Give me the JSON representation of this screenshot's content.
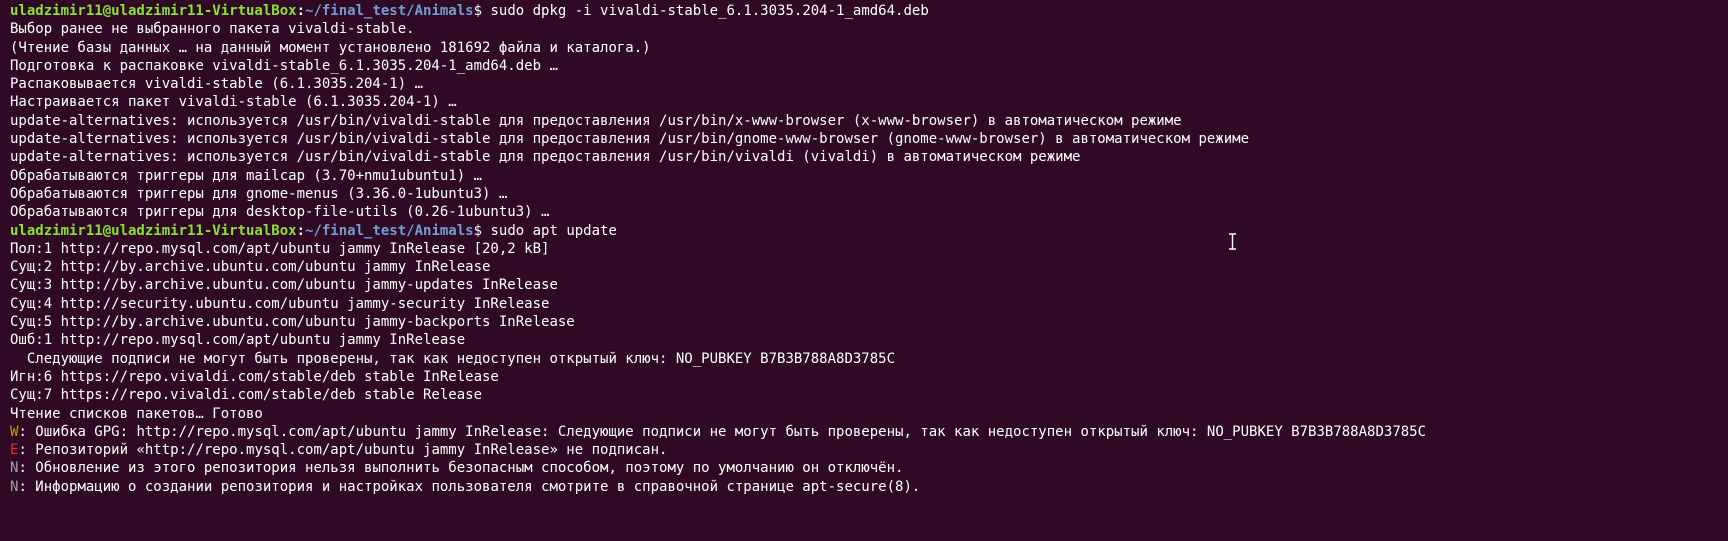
{
  "terminal": {
    "prompt": {
      "user_host": "uladzimir11@uladzimir11-VirtualBox",
      "separator": ":",
      "path": "~/final_test/Animals",
      "dollar": "$"
    },
    "colors": {
      "background": "#300a24",
      "user_host": "#8ae234",
      "path": "#729fcf",
      "text": "#ffffff",
      "warning_tag": "#c4a000",
      "error_tag": "#ef2929",
      "notice_tag": "#a0a0a0"
    },
    "commands": [
      " sudo dpkg -i vivaldi-stable_6.1.3035.204-1_amd64.deb",
      " sudo apt update"
    ],
    "dpkg_output": [
      "Выбор ранее не выбранного пакета vivaldi-stable.",
      "(Чтение базы данных … на данный момент установлено 181692 файла и каталога.)",
      "Подготовка к распаковке vivaldi-stable_6.1.3035.204-1_amd64.deb …",
      "Распаковывается vivaldi-stable (6.1.3035.204-1) …",
      "Настраивается пакет vivaldi-stable (6.1.3035.204-1) …",
      "update-alternatives: используется /usr/bin/vivaldi-stable для предоставления /usr/bin/x-www-browser (x-www-browser) в автоматическом режиме",
      "update-alternatives: используется /usr/bin/vivaldi-stable для предоставления /usr/bin/gnome-www-browser (gnome-www-browser) в автоматическом режиме",
      "update-alternatives: используется /usr/bin/vivaldi-stable для предоставления /usr/bin/vivaldi (vivaldi) в автоматическом режиме",
      "Обрабатываются триггеры для mailcap (3.70+nmu1ubuntu1) …",
      "Обрабатываются триггеры для gnome-menus (3.36.0-1ubuntu3) …",
      "Обрабатываются триггеры для desktop-file-utils (0.26-1ubuntu3) …"
    ],
    "apt_output": [
      "Пол:1 http://repo.mysql.com/apt/ubuntu jammy InRelease [20,2 kB]",
      "Сущ:2 http://by.archive.ubuntu.com/ubuntu jammy InRelease",
      "Сущ:3 http://by.archive.ubuntu.com/ubuntu jammy-updates InRelease",
      "Сущ:4 http://security.ubuntu.com/ubuntu jammy-security InRelease",
      "Сущ:5 http://by.archive.ubuntu.com/ubuntu jammy-backports InRelease",
      "Ошб:1 http://repo.mysql.com/apt/ubuntu jammy InRelease",
      "  Следующие подписи не могут быть проверены, так как недоступен открытый ключ: NO_PUBKEY B7B3B788A8D3785C",
      "Игн:6 https://repo.vivaldi.com/stable/deb stable InRelease",
      "Сущ:7 https://repo.vivaldi.com/stable/deb stable Release",
      "Чтение списков пакетов… Готово"
    ],
    "messages": [
      {
        "tag": "W",
        "text": ": Ошибка GPG: http://repo.mysql.com/apt/ubuntu jammy InRelease: Следующие подписи не могут быть проверены, так как недоступен открытый ключ: NO_PUBKEY B7B3B788A8D3785C"
      },
      {
        "tag": "E",
        "text": ": Репозиторий «http://repo.mysql.com/apt/ubuntu jammy InRelease» не подписан."
      },
      {
        "tag": "N",
        "text": ": Обновление из этого репозитория нельзя выполнить безопасным способом, поэтому по умолчанию он отключён."
      },
      {
        "tag": "N",
        "text": ": Информацию о создании репозитория и настройках пользователя смотрите в справочной странице apt-secure(8)."
      }
    ],
    "cursor_icon": "ibeam-cursor-icon"
  }
}
